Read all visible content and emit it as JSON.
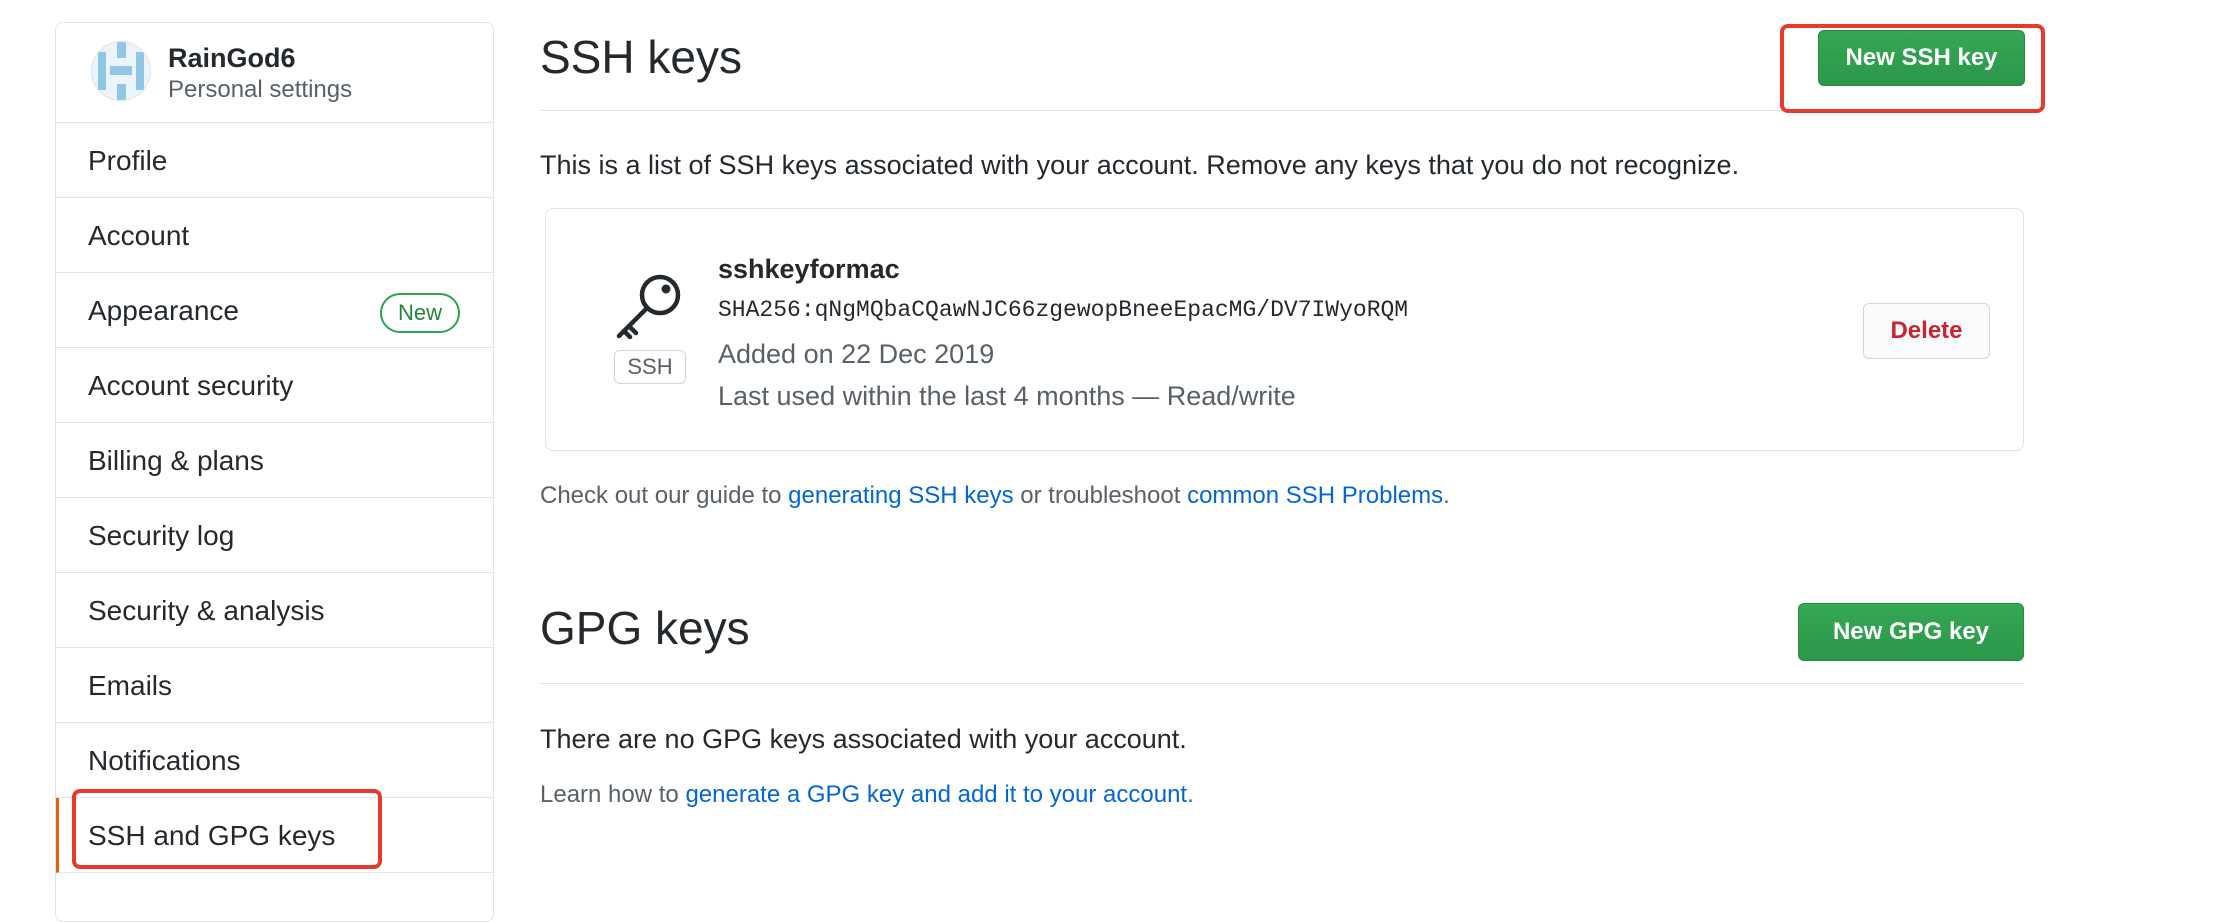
{
  "sidebar": {
    "user": {
      "name": "RainGod6",
      "subtitle": "Personal settings"
    },
    "items": [
      {
        "label": "Profile"
      },
      {
        "label": "Account"
      },
      {
        "label": "Appearance",
        "badge": "New"
      },
      {
        "label": "Account security"
      },
      {
        "label": "Billing & plans"
      },
      {
        "label": "Security log"
      },
      {
        "label": "Security & analysis"
      },
      {
        "label": "Emails"
      },
      {
        "label": "Notifications"
      },
      {
        "label": "SSH and GPG keys",
        "selected": true
      }
    ]
  },
  "ssh": {
    "title": "SSH keys",
    "new_button": "New SSH key",
    "description": "This is a list of SSH keys associated with your account. Remove any keys that you do not recognize.",
    "key": {
      "icon": "key-icon",
      "type_tag": "SSH",
      "name": "sshkeyformac",
      "fingerprint": "SHA256:qNgMQbaCQawNJC66zgewopBneeEpacMG/DV7IWyoRQM",
      "added": "Added on 22 Dec 2019",
      "last_used": "Last used within the last 4 months — Read/write",
      "delete_button": "Delete"
    },
    "guide": {
      "prefix": "Check out our guide to ",
      "link1": "generating SSH keys",
      "middle": " or troubleshoot ",
      "link2": "common SSH Problems",
      "suffix": "."
    }
  },
  "gpg": {
    "title": "GPG keys",
    "new_button": "New GPG key",
    "empty_text": "There are no GPG keys associated with your account.",
    "learn": {
      "prefix": "Learn how to ",
      "link": "generate a GPG key and add it to your account",
      "suffix": "."
    }
  },
  "colors": {
    "accent_green": "#2ea44f",
    "link_blue": "#0366d6",
    "danger_red": "#cb2431",
    "highlight_red": "#e8392a",
    "selected_border": "#e36209"
  }
}
